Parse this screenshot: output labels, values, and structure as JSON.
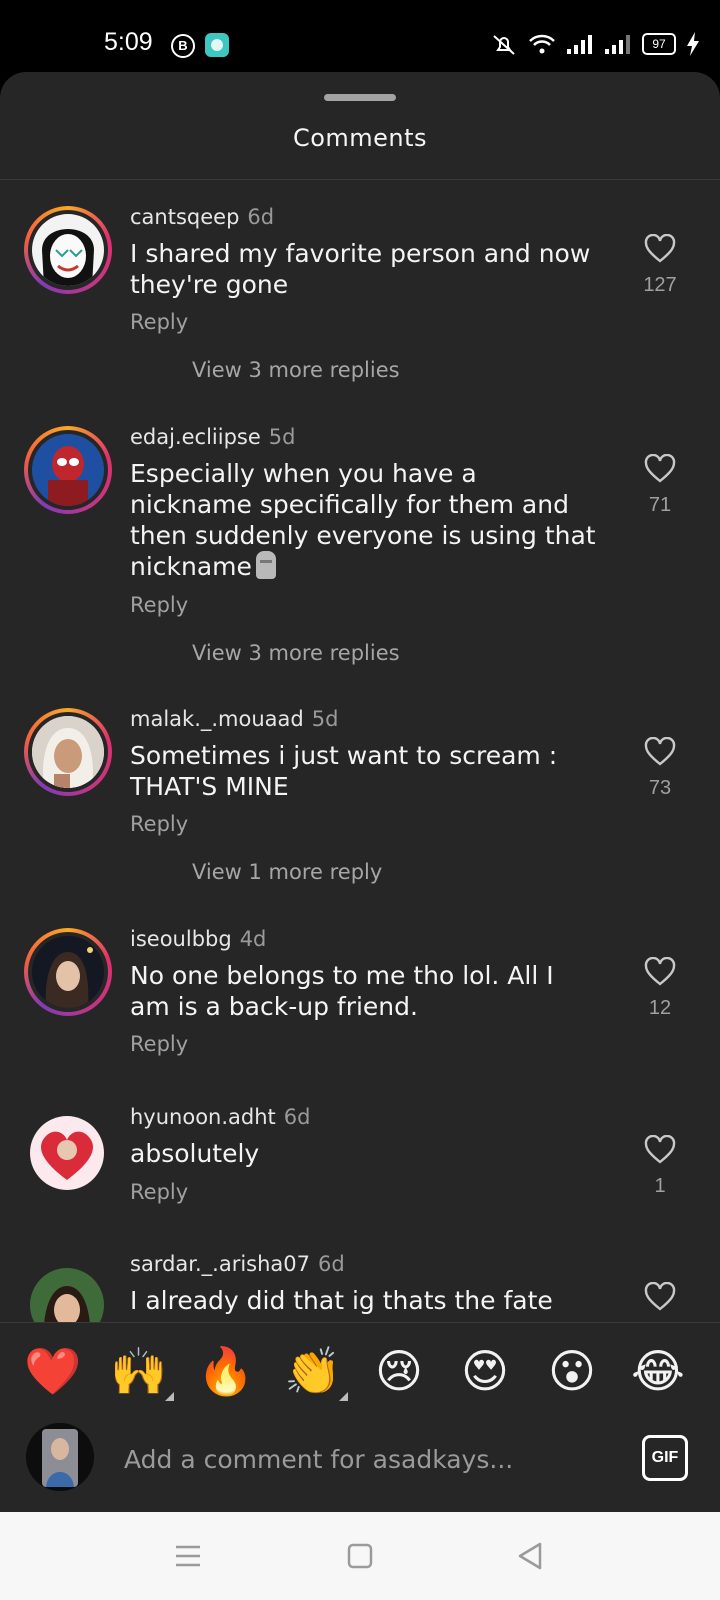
{
  "status_bar": {
    "time": "5:09",
    "b_badge": "B",
    "battery": "97"
  },
  "sheet": {
    "title": "Comments"
  },
  "comments": [
    {
      "username": "cantsqeep",
      "time": "6d",
      "text": "I shared my favorite person and now they're gone",
      "reply": "Reply",
      "likes": "127",
      "view_more": "View 3 more replies"
    },
    {
      "username": "edaj.ecliipse",
      "time": "5d",
      "text": "Especially when you have a nickname specifically for them and then suddenly everyone is using that nickname",
      "reply": "Reply",
      "likes": "71",
      "view_more": "View 3 more replies"
    },
    {
      "username": "malak._.mouaad",
      "time": "5d",
      "text": "Sometimes i just want to scream : THAT'S MINE",
      "reply": "Reply",
      "likes": "73",
      "view_more": "View 1 more reply"
    },
    {
      "username": "iseoulbbg",
      "time": "4d",
      "text": "No one belongs to me tho lol. All I am is a back-up friend.",
      "reply": "Reply",
      "likes": "12"
    },
    {
      "username": "hyunoon.adht",
      "time": "6d",
      "text": "absolutely",
      "reply": "Reply",
      "likes": "1"
    },
    {
      "username": "sardar._.arisha07",
      "time": "6d",
      "text": "I already did that ig thats the fate"
    }
  ],
  "emoji_bar": [
    "❤️",
    "🙌",
    "🔥",
    "👏",
    "😢",
    "😍",
    "😮",
    "😂"
  ],
  "composer": {
    "placeholder": "Add a comment for asadkays...",
    "gif_label": "GIF"
  },
  "icons": {
    "like": "heart-outline-icon",
    "moai": "moai-emoji-icon"
  }
}
